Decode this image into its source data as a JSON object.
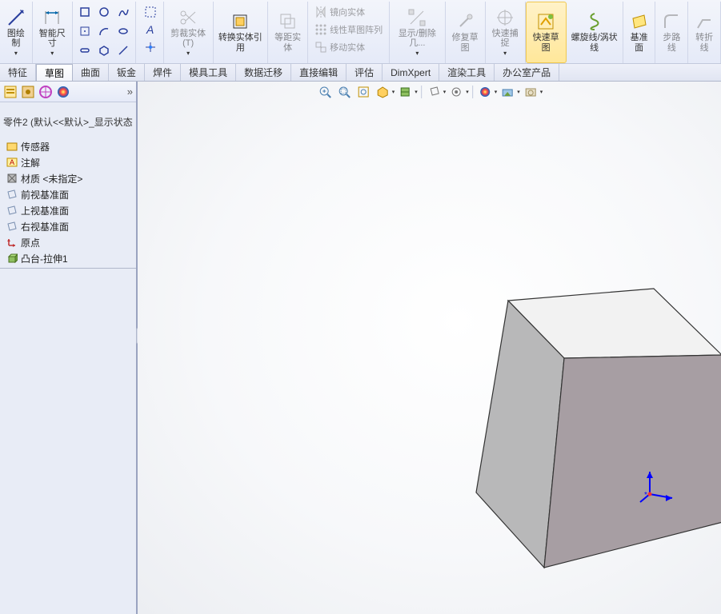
{
  "ribbon": {
    "sketch_draw": "图绘制",
    "smart_dim": "智能尺寸",
    "trim": "剪裁实体(T)",
    "convert": "转换实体引用",
    "offset": "等距实体",
    "mirror": "镜向实体",
    "linear_pattern": "线性草图阵列",
    "move": "移动实体",
    "display_delete": "显示/删除几...",
    "repair": "修复草图",
    "quick_snap": "快速捕捉",
    "quick_sketch": "快速草图",
    "helix": "螺旋线/涡状线",
    "ref_plane": "基准面",
    "route": "步路线",
    "bend": "转折线"
  },
  "tabs": [
    "特征",
    "草图",
    "曲面",
    "钣金",
    "焊件",
    "模具工具",
    "数据迁移",
    "直接编辑",
    "评估",
    "DimXpert",
    "渲染工具",
    "办公室产品"
  ],
  "active_tab_index": 1,
  "tree": {
    "title": "零件2  (默认<<默认>_显示状态",
    "items": [
      {
        "icon": "sensor",
        "label": "传感器"
      },
      {
        "icon": "annotation",
        "label": "注解"
      },
      {
        "icon": "material",
        "label": "材质 <未指定>"
      },
      {
        "icon": "plane",
        "label": "前视基准面"
      },
      {
        "icon": "plane",
        "label": "上视基准面"
      },
      {
        "icon": "plane",
        "label": "右视基准面"
      },
      {
        "icon": "origin",
        "label": "原点"
      },
      {
        "icon": "extrude",
        "label": "凸台-拉伸1"
      }
    ]
  },
  "viewport_tools": [
    "zoom-in",
    "zoom-out",
    "zoom-fit",
    "rotate",
    "section",
    "display-style",
    "perspective",
    "edges",
    "appearance",
    "scene",
    "capture"
  ]
}
